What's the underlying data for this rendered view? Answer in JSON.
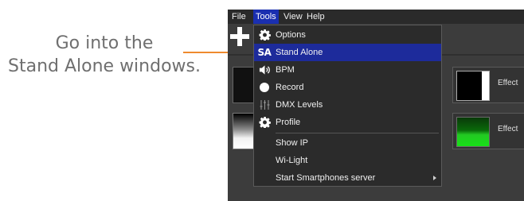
{
  "caption": {
    "line1": "Go into the",
    "line2": "Stand Alone windows."
  },
  "colors": {
    "pointer_line": "#ef8a2e",
    "highlight": "#1d2b9b",
    "menubar_active": "#1a2fb0"
  },
  "menubar": {
    "items": [
      {
        "label": "File"
      },
      {
        "label": "Tools"
      },
      {
        "label": "View"
      },
      {
        "label": "Help"
      }
    ],
    "active": "Tools"
  },
  "tools_menu": {
    "items": [
      {
        "label": "Options",
        "icon": "gear-icon"
      },
      {
        "label": "Stand Alone",
        "icon": "stand-alone-icon",
        "icon_text": "SA",
        "highlighted": true
      },
      {
        "label": "BPM",
        "icon": "speaker-icon"
      },
      {
        "label": "Record",
        "icon": "record-dot-icon"
      },
      {
        "label": "DMX Levels",
        "icon": "sliders-icon"
      },
      {
        "label": "Profile",
        "icon": "gear-icon"
      },
      {
        "label": "Show IP"
      },
      {
        "label": "Wi-Light"
      },
      {
        "label": "Start Smartphones server",
        "has_submenu": true
      }
    ]
  },
  "effects": {
    "tile1_label": "Effect",
    "tile2_label": "Effect"
  }
}
